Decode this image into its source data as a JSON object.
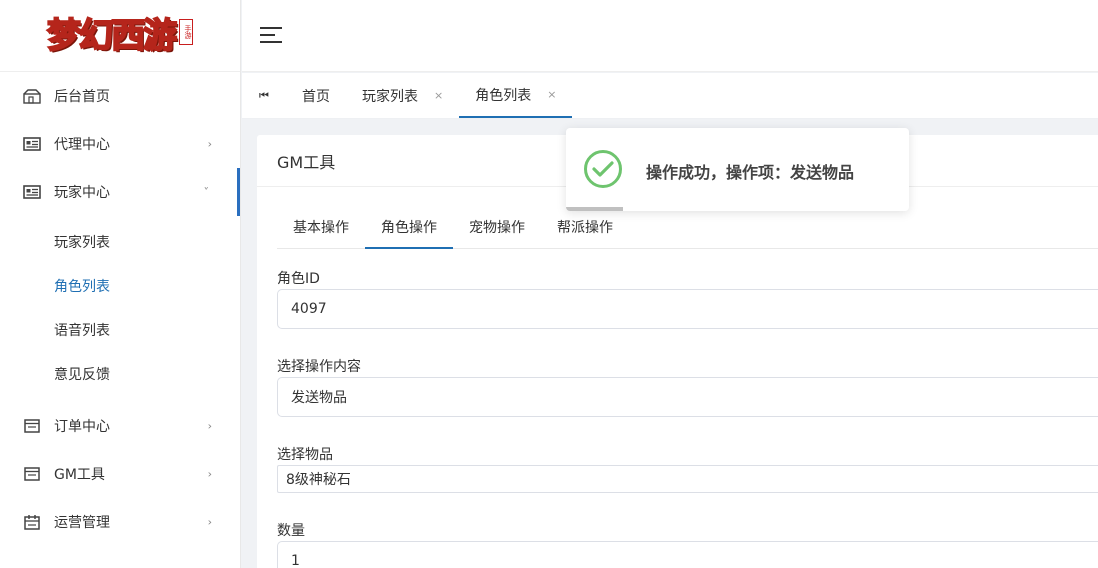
{
  "logo": {
    "text": "梦幻西游",
    "seal": "手游"
  },
  "sidebar": {
    "items": [
      {
        "label": "后台首页",
        "icon": "home-icon"
      },
      {
        "label": "代理中心",
        "icon": "id-card-icon",
        "arrow": "›"
      },
      {
        "label": "玩家中心",
        "icon": "id-card-icon",
        "arrow": "˅",
        "children": [
          {
            "label": "玩家列表"
          },
          {
            "label": "角色列表",
            "active": true
          },
          {
            "label": "语音列表"
          },
          {
            "label": "意见反馈"
          }
        ]
      },
      {
        "label": "订单中心",
        "icon": "list-icon",
        "arrow": "›"
      },
      {
        "label": "GM工具",
        "icon": "list-icon",
        "arrow": "›"
      },
      {
        "label": "运营管理",
        "icon": "calendar-icon",
        "arrow": "›"
      }
    ]
  },
  "tabs": {
    "nav_icon": "⏮",
    "items": [
      {
        "label": "首页"
      },
      {
        "label": "玩家列表",
        "close": "×"
      },
      {
        "label": "角色列表",
        "close": "×",
        "active": true
      }
    ]
  },
  "card": {
    "title": "GM工具",
    "inner_tabs": [
      "基本操作",
      "角色操作",
      "宠物操作",
      "帮派操作"
    ],
    "active_inner_tab": "角色操作",
    "form": {
      "role_id_label": "角色ID",
      "role_id_value": "4097",
      "operation_label": "选择操作内容",
      "operation_value": "发送物品",
      "item_label": "选择物品",
      "item_value": "8级神秘石",
      "quantity_label": "数量",
      "quantity_value": "1"
    }
  },
  "toast": {
    "message": "操作成功，操作项：发送物品"
  },
  "colors": {
    "accent": "#1f6fb3",
    "success": "#6ec46e",
    "sidebar_bar": "#2a6fbf"
  }
}
